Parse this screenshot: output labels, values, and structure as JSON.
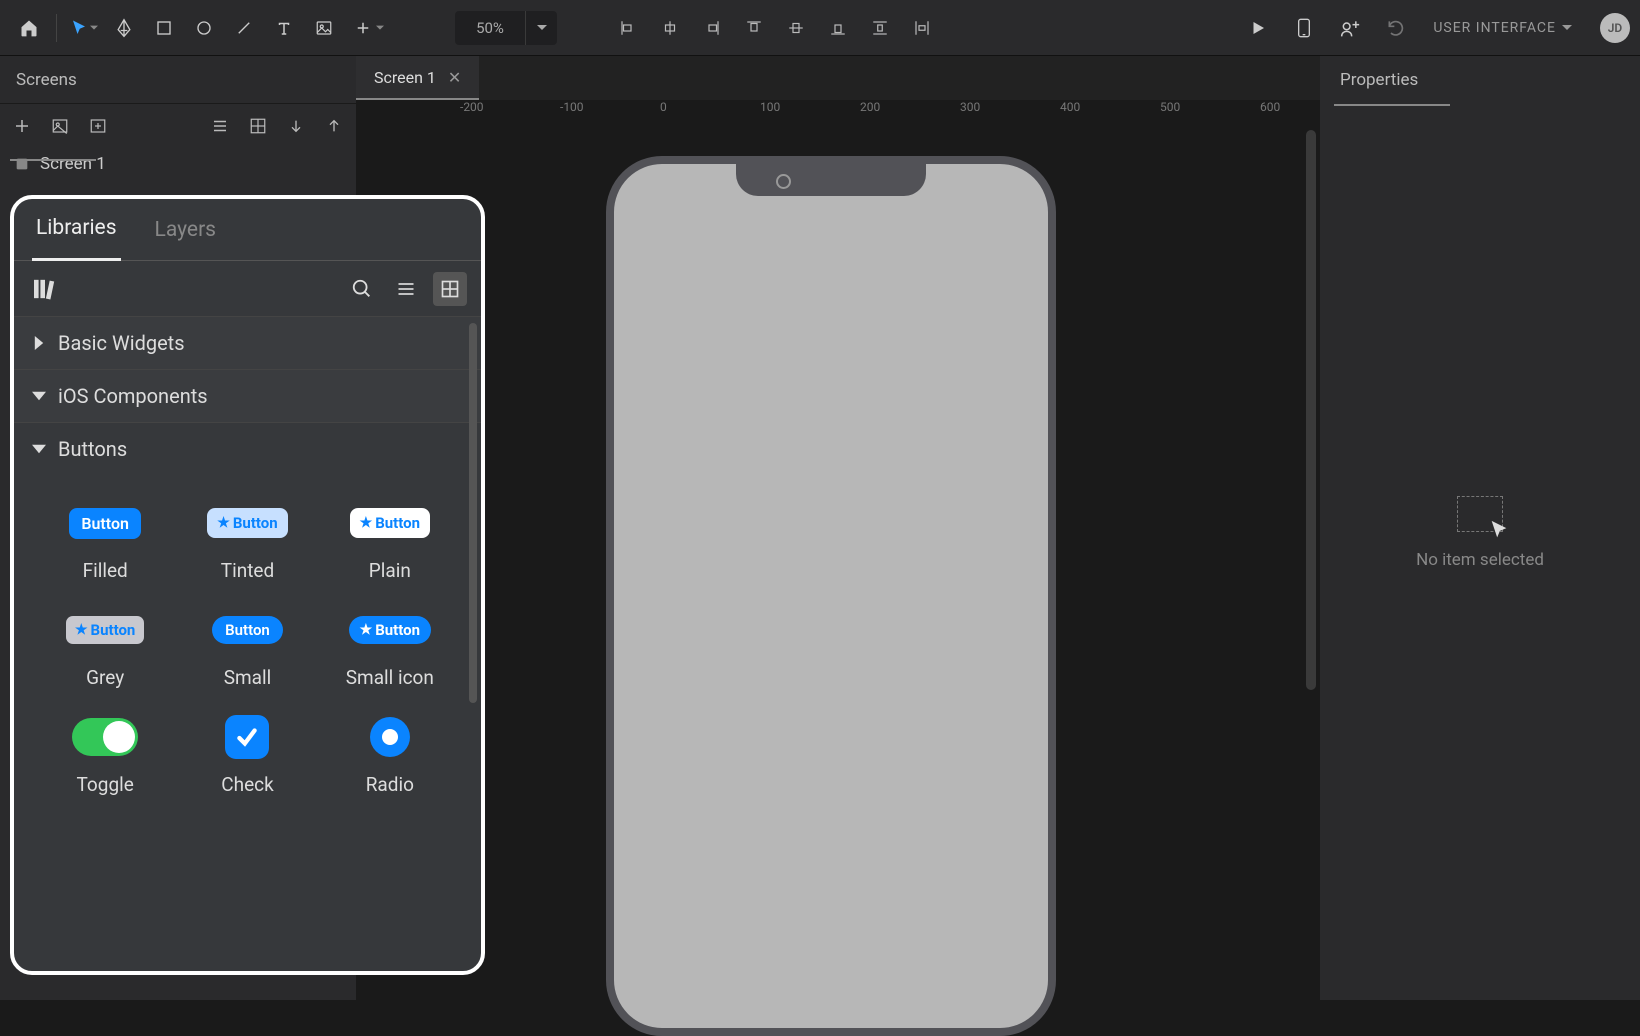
{
  "toolbar": {
    "zoom": "50%",
    "project_menu": "USER INTERFACE",
    "avatar_initials": "JD"
  },
  "screens": {
    "header": "Screens",
    "items": [
      "Screen 1"
    ]
  },
  "popover": {
    "tabs": {
      "libraries": "Libraries",
      "layers": "Layers"
    },
    "sections": {
      "basic": "Basic Widgets",
      "ios": "iOS Components",
      "buttons": "Buttons"
    },
    "components": {
      "filled": {
        "label": "Filled",
        "inner": "Button"
      },
      "tinted": {
        "label": "Tinted",
        "inner": "Button"
      },
      "plain": {
        "label": "Plain",
        "inner": "Button"
      },
      "grey": {
        "label": "Grey",
        "inner": "Button"
      },
      "small": {
        "label": "Small",
        "inner": "Button"
      },
      "smicon": {
        "label": "Small icon",
        "inner": "Button"
      },
      "toggle": {
        "label": "Toggle"
      },
      "check": {
        "label": "Check"
      },
      "radio": {
        "label": "Radio"
      }
    }
  },
  "canvas": {
    "tab_label": "Screen 1",
    "ruler_labels": [
      "-200",
      "-100",
      "0",
      "100",
      "200",
      "300",
      "400",
      "500",
      "600"
    ]
  },
  "props": {
    "header": "Properties",
    "empty": "No item selected"
  }
}
